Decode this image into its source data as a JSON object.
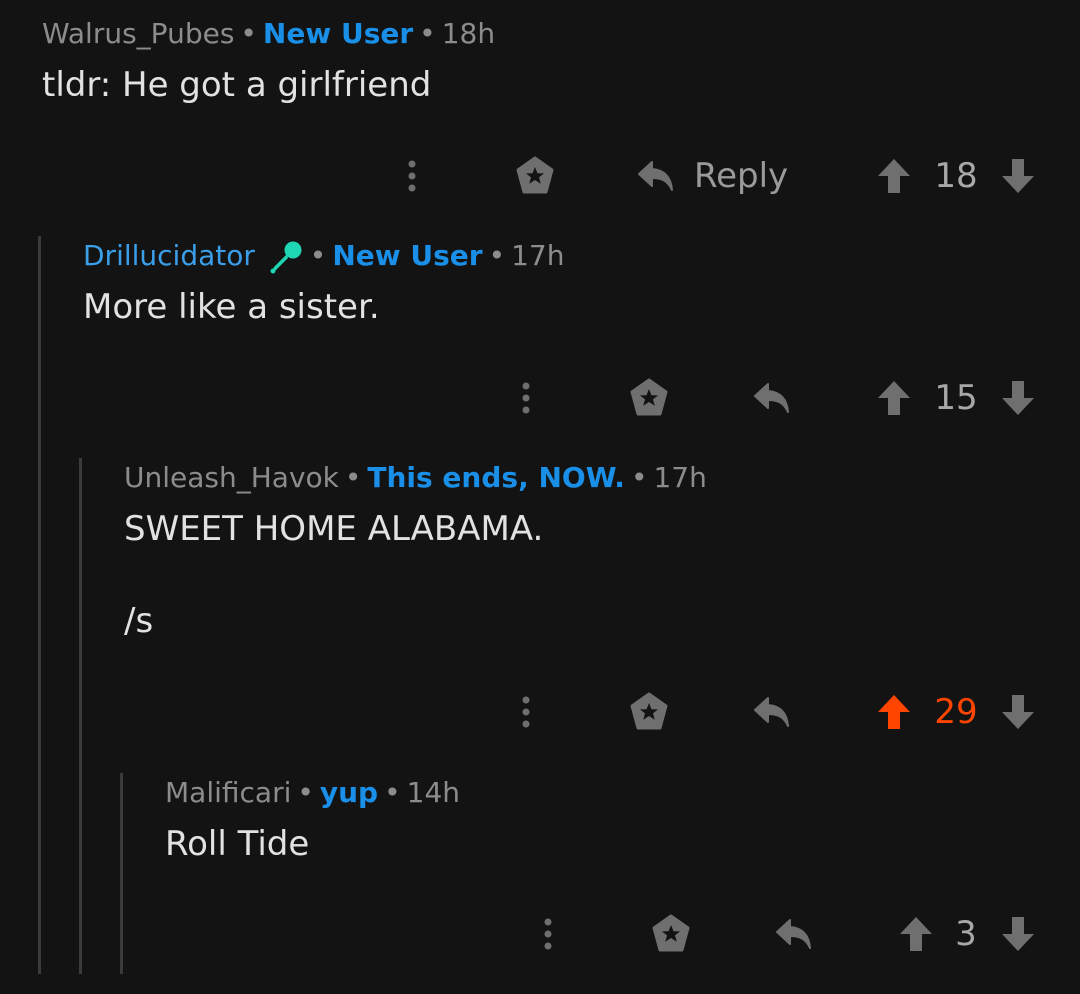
{
  "colors": {
    "background": "#131313",
    "meta_gray": "#8c8c8c",
    "flair_blue": "#1a8fe8",
    "upvote_orange": "#ff4500",
    "icon_gray": "#6f6f6f",
    "mic_teal": "#1ed6b4"
  },
  "comments": [
    {
      "author": "Walrus_Pubes",
      "flair": "New User",
      "time": "18h",
      "body": "tldr: He got a girlfriend",
      "reply_label": "Reply",
      "score": "18",
      "upvoted": false
    },
    {
      "author": "Drillucidator",
      "author_icon": "microphone-icon",
      "flair": "New User",
      "time": "17h",
      "body": "More like a sister.",
      "score": "15",
      "upvoted": false
    },
    {
      "author": "Unleash_Havok",
      "flair": "This ends, NOW.",
      "time": "17h",
      "body": "SWEET HOME ALABAMA.\n\n/s",
      "score": "29",
      "upvoted": true
    },
    {
      "author": "Malificari",
      "flair": "yup",
      "time": "14h",
      "body": "Roll Tide",
      "score": "3",
      "upvoted": false
    }
  ]
}
